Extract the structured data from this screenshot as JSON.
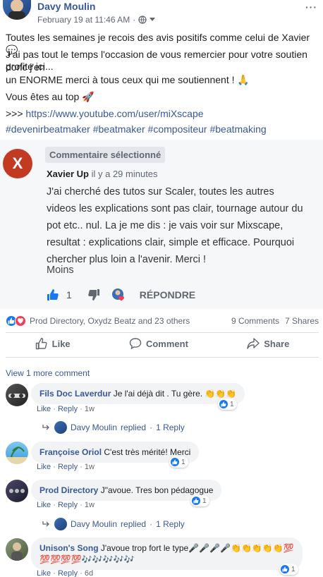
{
  "post": {
    "author": "Davy Moulin",
    "timestamp": "February 19 at 11:46 AM",
    "meta_sep": "·",
    "lines": [
      "Toutes les semaines je recois des avis positifs comme celui de Xavier 💬",
      "J'ai pas tout le temps l'occasion de vous remercier pour votre soutien donc j'en",
      "profite ici...",
      "un ENORME merci à tous ceux qui me soutiennent ! 🙏",
      "Vous êtes au top 🚀"
    ],
    "link_prefix": ">>> ",
    "link": "https://www.youtube.com/user/miXscape",
    "hashtags": "#devenirbeatmaker #beatmaker #compositeur #beatmaking"
  },
  "selected_comment": {
    "badge": "Commentaire sélectionné",
    "avatar_letter": "X",
    "author": "Xavier Up",
    "time": "il y a 29 minutes",
    "text_lines": [
      "J'ai cherché des tutos sur Scaler, toutes les autres",
      "videos les explications sont pas clair, tournage autour du",
      "pot etc.. nul. La je me dis : je vais voir sur Mixscape,",
      "resultat : explications clair, simple et efficace. Pourquoi",
      "chercher plus loin a l'avenir. Merci !"
    ],
    "moins": "Moins",
    "like_count": "1",
    "reply_label": "RÉPONDRE"
  },
  "reactions": {
    "text": "Prod Directory, Oxydz Beatz and 23 others",
    "comments": "9 Comments",
    "shares": "7 Shares"
  },
  "actions": {
    "like": "Like",
    "comment": "Comment",
    "share": "Share"
  },
  "view_more": "View 1 more comment",
  "comments": [
    {
      "author": "Fils Doc Laverdur",
      "text": "Je l'ai déjà dit . Tu gère. 👏👏👏",
      "like": "Like",
      "reply": "Reply",
      "time": "1w",
      "react_count": "1"
    },
    {
      "author": "Françoise Oriol",
      "text": "C'est très mérité! Merci",
      "like": "Like",
      "reply": "Reply",
      "time": "1w",
      "react_count": "1"
    },
    {
      "author": "Prod Directory",
      "text": "J\"avoue. Tres bon pédagogue",
      "like": "Like",
      "reply": "Reply",
      "time": "1w",
      "react_count": "1"
    },
    {
      "author": "Unison's Song",
      "text": "J'avoue trop fort le type🎤🎤🎤🎤👏👏👏👏👏💯",
      "text2": "💯💯💯💯🎶🎶🎶🎶🎶",
      "like": "Like",
      "reply": "Reply",
      "time": "6d",
      "react_count": "1"
    }
  ],
  "replies": [
    {
      "name": "Davy Moulin",
      "action": "replied",
      "sep": "·",
      "count": "1 Reply"
    },
    {
      "name": "Davy Moulin",
      "action": "replied",
      "sep": "·",
      "count": "1 Reply"
    }
  ],
  "colors": {
    "link": "#385898",
    "like_blue": "#1877f2",
    "love_red": "#f33e58",
    "selected_bg": "#f6f7f9"
  }
}
